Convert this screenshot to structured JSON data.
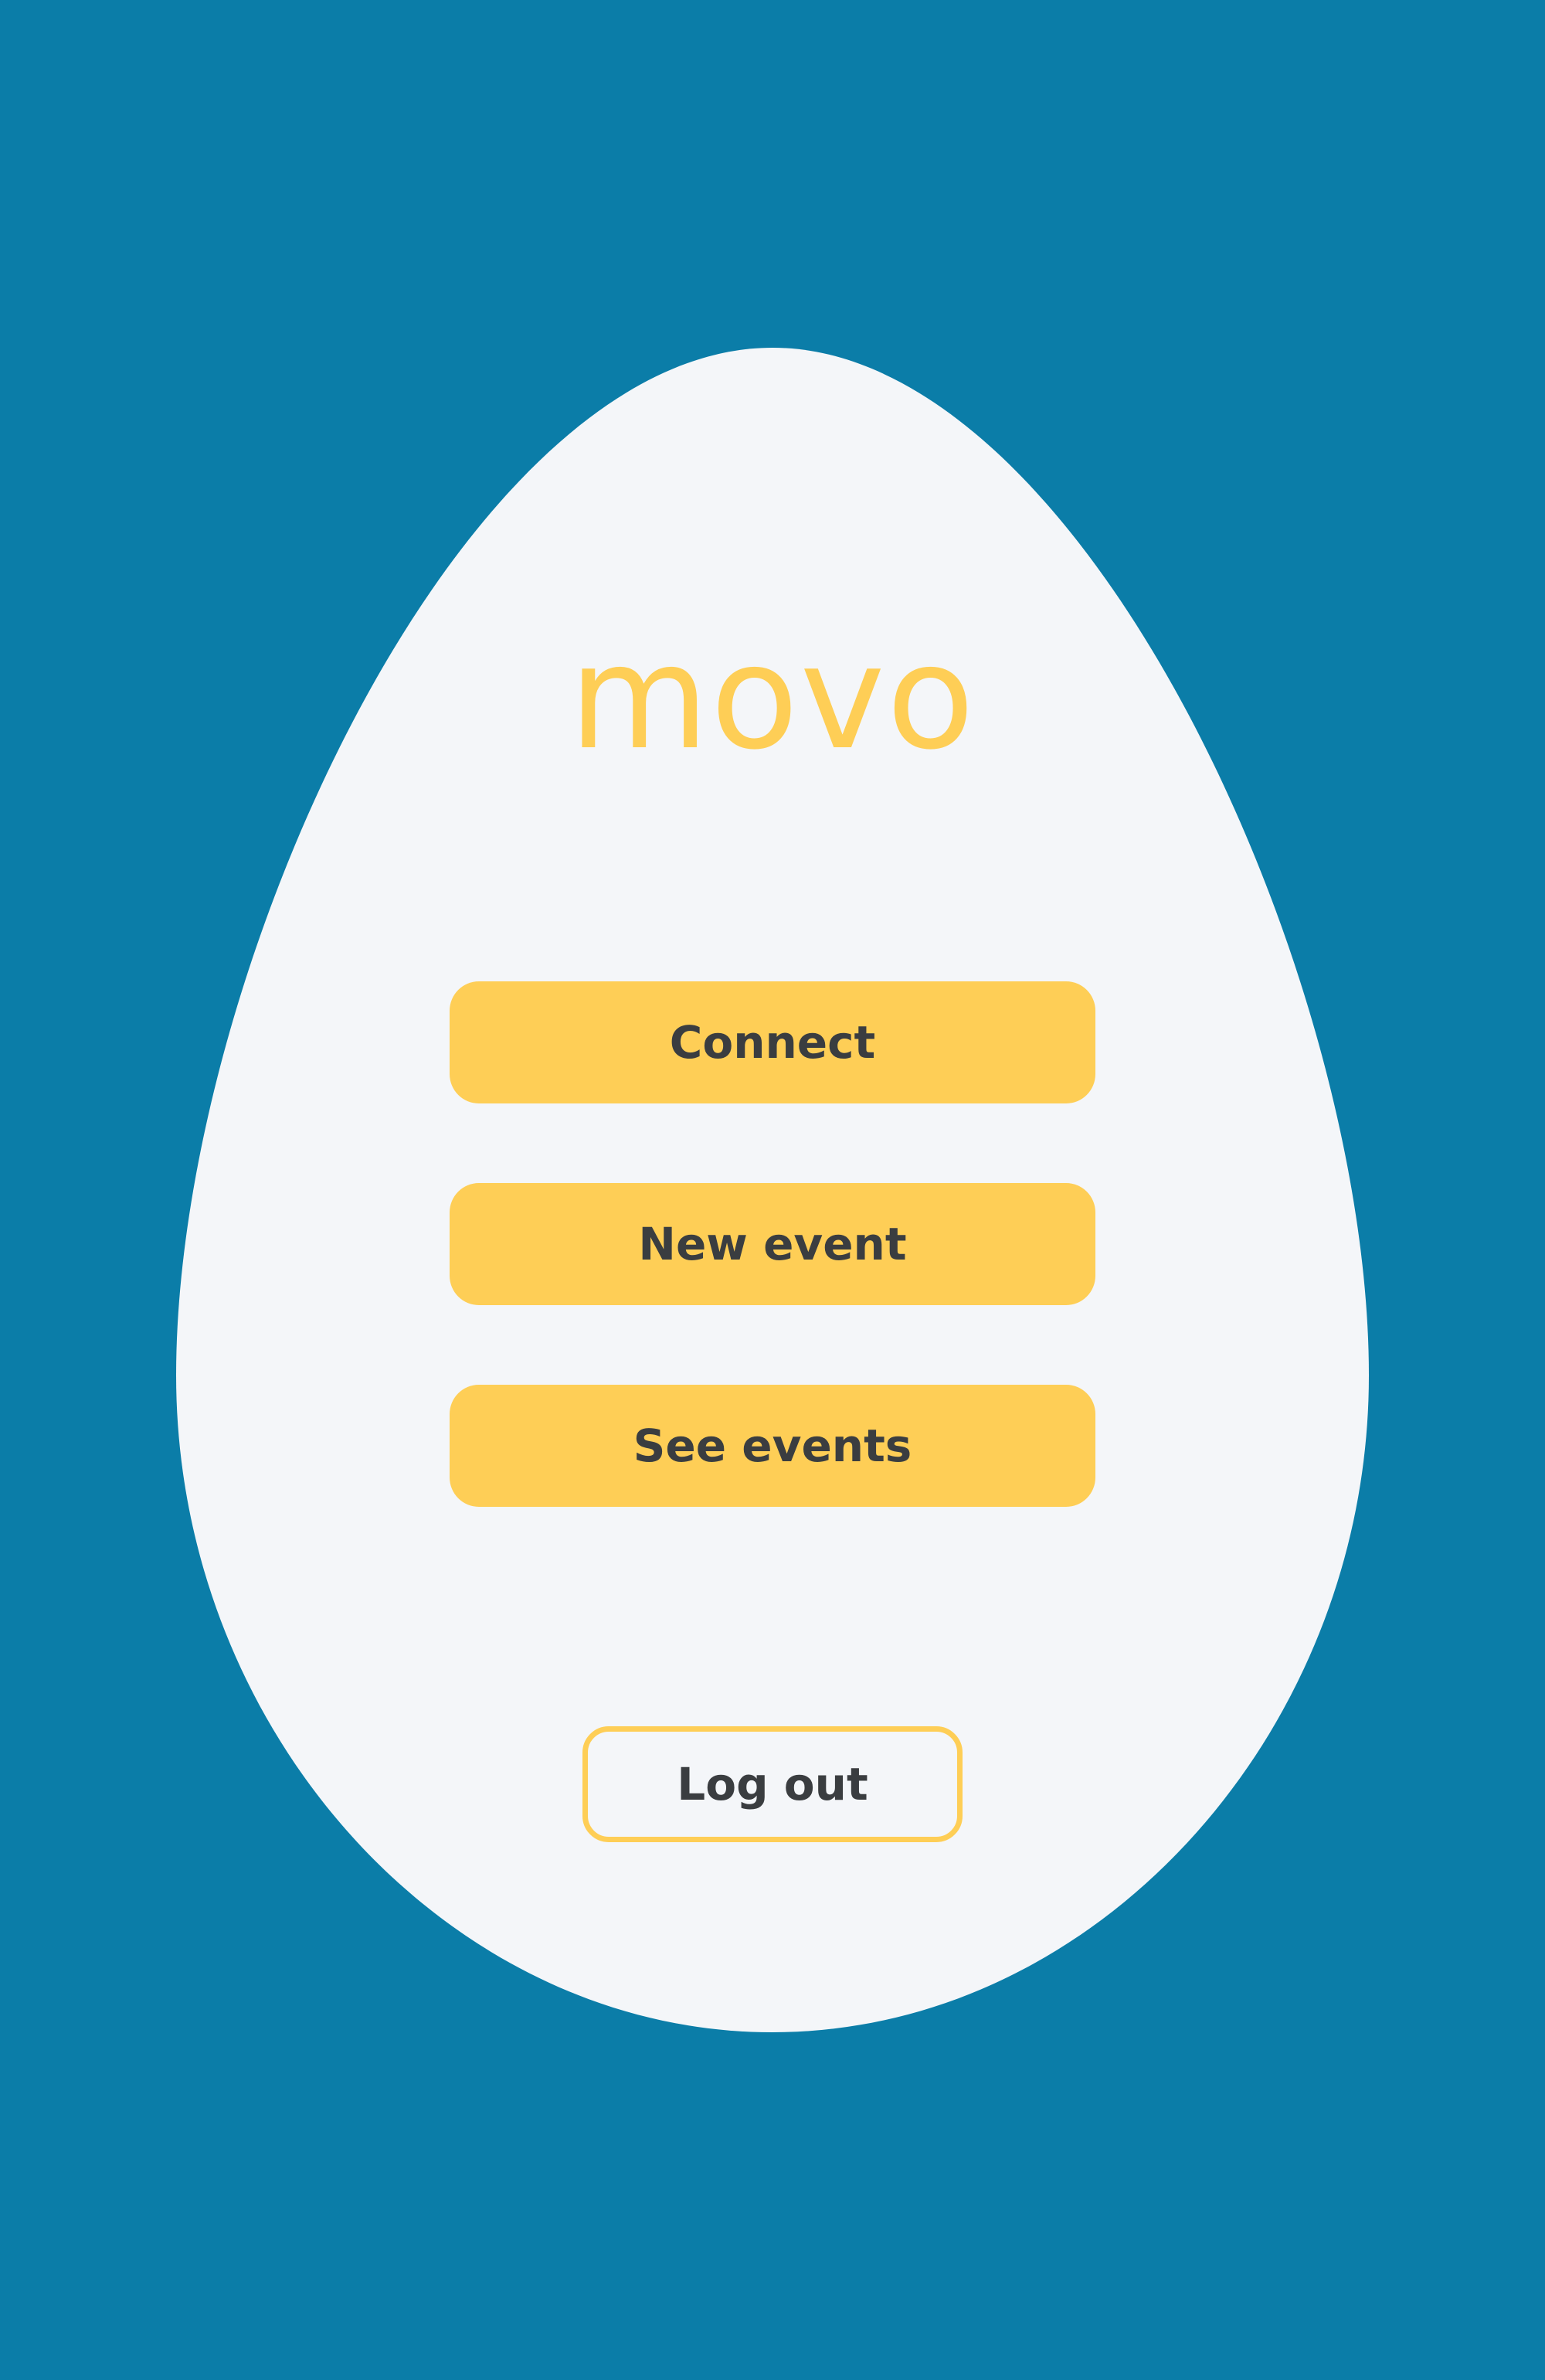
{
  "app": {
    "logo_text": "movo"
  },
  "menu": {
    "connect_label": "Connect",
    "new_event_label": "New event",
    "see_events_label": "See events",
    "logout_label": "Log out"
  },
  "colors": {
    "background": "#0b7da8",
    "card": "#f4f6f9",
    "accent": "#fece56",
    "button_text": "#3a3d40"
  }
}
